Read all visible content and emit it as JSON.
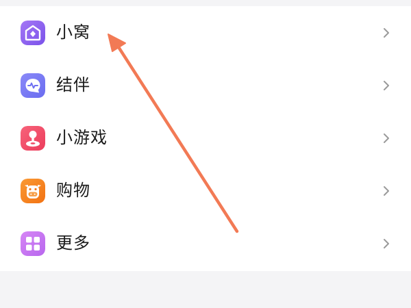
{
  "menu": {
    "items": [
      {
        "label": "小窝",
        "icon": "home-diamond-icon",
        "color": "#8b63f0"
      },
      {
        "label": "结伴",
        "icon": "chat-pulse-icon",
        "color": "#7a7cf5"
      },
      {
        "label": "小游戏",
        "icon": "joystick-icon",
        "color": "#f24e6a"
      },
      {
        "label": "购物",
        "icon": "cow-face-icon",
        "color": "#f7841f"
      },
      {
        "label": "更多",
        "icon": "grid-four-icon",
        "color": "#c779f2"
      }
    ],
    "chevron_icon": "chevron-right-icon"
  },
  "annotation": {
    "arrow_color": "#f27a55",
    "arrow_icon": "arrow-annotation-icon"
  }
}
